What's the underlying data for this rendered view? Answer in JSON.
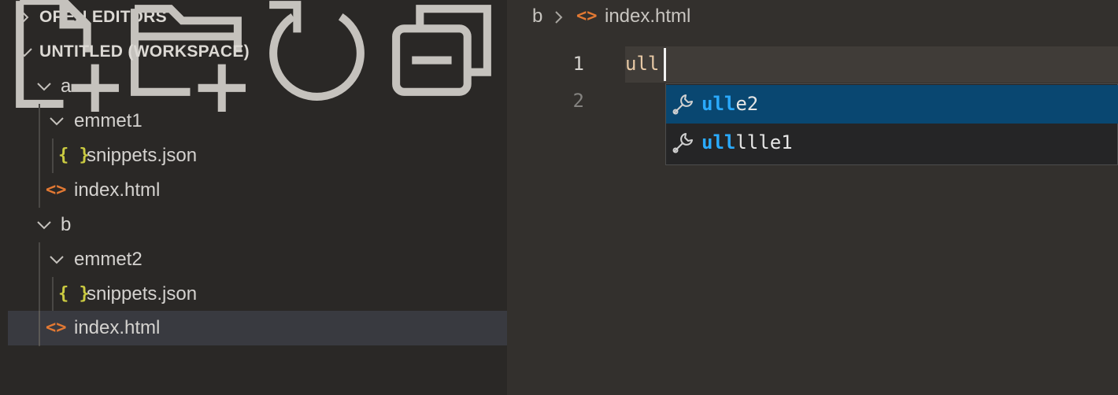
{
  "sidebar": {
    "open_editors_label": "OPEN EDITORS",
    "workspace_label": "UNTITLED (WORKSPACE)",
    "actions": [
      "new-file-icon",
      "new-folder-icon",
      "refresh-icon",
      "collapse-all-icon"
    ],
    "tree": [
      {
        "label": "a",
        "type": "folder",
        "expanded": true
      },
      {
        "label": "emmet1",
        "type": "folder",
        "expanded": true
      },
      {
        "label": "snippets.json",
        "type": "json",
        "icon": "{ }"
      },
      {
        "label": "index.html",
        "type": "html",
        "icon": "<>"
      },
      {
        "label": "b",
        "type": "folder",
        "expanded": true
      },
      {
        "label": "emmet2",
        "type": "folder",
        "expanded": true
      },
      {
        "label": "snippets.json",
        "type": "json",
        "icon": "{ }"
      },
      {
        "label": "index.html",
        "type": "html",
        "icon": "<>",
        "selected": true
      }
    ]
  },
  "editor": {
    "breadcrumb": {
      "folder": "b",
      "file_icon": "<>",
      "file": "index.html"
    },
    "line_numbers": [
      "1",
      "2"
    ],
    "line1_text": "ull",
    "suggestions": [
      {
        "match": "ull",
        "rest": "e2",
        "icon": "wrench-icon"
      },
      {
        "match": "ull",
        "rest": "llle1",
        "icon": "wrench-icon"
      }
    ]
  },
  "colors": {
    "sidebar_bg": "#2a2826",
    "editor_bg": "#33302d",
    "selected_row": "#393a40",
    "suggest_active": "#094771",
    "match_highlight": "#2aaaff",
    "html_icon": "#e37933",
    "json_icon": "#cbcb41"
  }
}
